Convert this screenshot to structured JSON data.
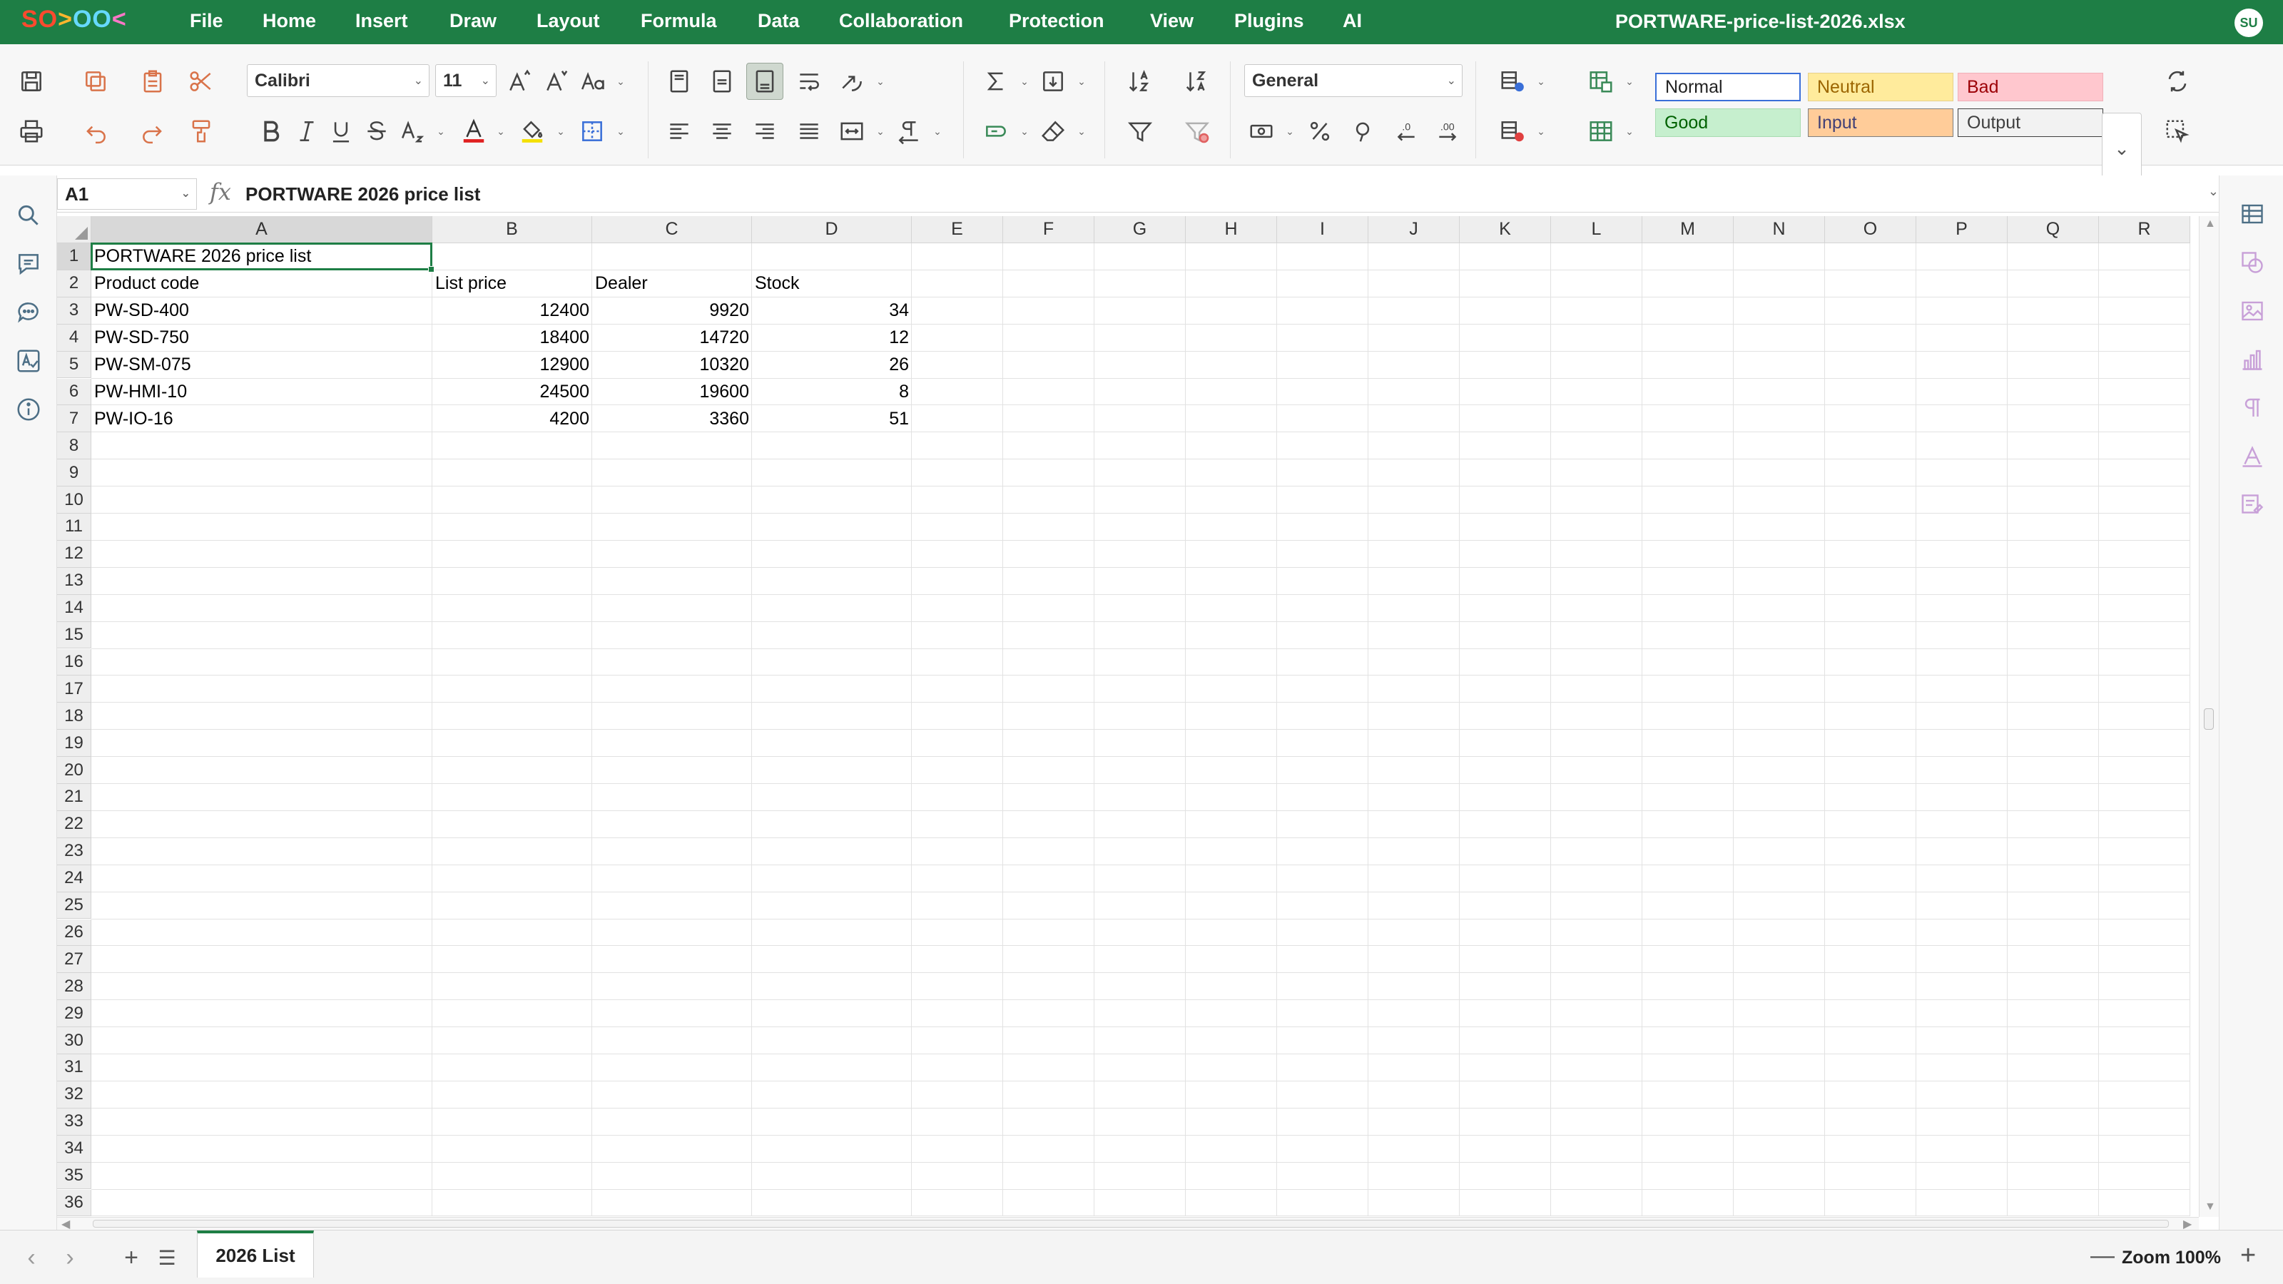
{
  "app": {
    "logo": [
      "SO",
      ">",
      "OO",
      "<"
    ],
    "document_title": "PORTWARE-price-list-2026.xlsx",
    "user_initials": "SU"
  },
  "menu": [
    "File",
    "Home",
    "Insert",
    "Draw",
    "Layout",
    "Formula",
    "Data",
    "Collaboration",
    "Protection",
    "View",
    "Plugins",
    "AI"
  ],
  "toolbar": {
    "font_name": "Calibri",
    "font_size": "11",
    "number_format": "General"
  },
  "cell_styles": [
    {
      "label": "Normal",
      "bg": "#ffffff",
      "fg": "#222222",
      "border": "#3a6fd8"
    },
    {
      "label": "Neutral",
      "bg": "#ffeb9c",
      "fg": "#9c6500",
      "border": "#e6d08a"
    },
    {
      "label": "Bad",
      "bg": "#ffc7ce",
      "fg": "#9c0006",
      "border": "#f0b0b8"
    },
    {
      "label": "Good",
      "bg": "#c6efce",
      "fg": "#006100",
      "border": "#a9dcb2"
    },
    {
      "label": "Input",
      "bg": "#ffcc99",
      "fg": "#3f3f76",
      "border": "#7f7f7f"
    },
    {
      "label": "Output",
      "bg": "#f2f2f2",
      "fg": "#3f3f3f",
      "border": "#3f3f3f"
    }
  ],
  "formula_bar": {
    "name_box": "A1",
    "fx": "fx",
    "value": "PORTWARE 2026 price list"
  },
  "sheet": {
    "columns": [
      "A",
      "B",
      "C",
      "D",
      "E",
      "F",
      "G",
      "H",
      "I",
      "J",
      "K",
      "L",
      "M",
      "N",
      "O",
      "P",
      "Q",
      "R"
    ],
    "row_count": 36,
    "active_cell": "A1",
    "cells": [
      {
        "ref": "A1",
        "value": "PORTWARE 2026 price list",
        "align": "left"
      },
      {
        "ref": "A2",
        "value": "Product code",
        "align": "left"
      },
      {
        "ref": "B2",
        "value": "List price",
        "align": "left"
      },
      {
        "ref": "C2",
        "value": "Dealer",
        "align": "left"
      },
      {
        "ref": "D2",
        "value": "Stock",
        "align": "left"
      },
      {
        "ref": "A3",
        "value": "PW-SD-400",
        "align": "left"
      },
      {
        "ref": "B3",
        "value": "12400",
        "align": "right"
      },
      {
        "ref": "C3",
        "value": "9920",
        "align": "right"
      },
      {
        "ref": "D3",
        "value": "34",
        "align": "right"
      },
      {
        "ref": "A4",
        "value": "PW-SD-750",
        "align": "left"
      },
      {
        "ref": "B4",
        "value": "18400",
        "align": "right"
      },
      {
        "ref": "C4",
        "value": "14720",
        "align": "right"
      },
      {
        "ref": "D4",
        "value": "12",
        "align": "right"
      },
      {
        "ref": "A5",
        "value": "PW-SM-075",
        "align": "left"
      },
      {
        "ref": "B5",
        "value": "12900",
        "align": "right"
      },
      {
        "ref": "C5",
        "value": "10320",
        "align": "right"
      },
      {
        "ref": "D5",
        "value": "26",
        "align": "right"
      },
      {
        "ref": "A6",
        "value": "PW-HMI-10",
        "align": "left"
      },
      {
        "ref": "B6",
        "value": "24500",
        "align": "right"
      },
      {
        "ref": "C6",
        "value": "19600",
        "align": "right"
      },
      {
        "ref": "D6",
        "value": "8",
        "align": "right"
      },
      {
        "ref": "A7",
        "value": "PW-IO-16",
        "align": "left"
      },
      {
        "ref": "B7",
        "value": "4200",
        "align": "right"
      },
      {
        "ref": "C7",
        "value": "3360",
        "align": "right"
      },
      {
        "ref": "D7",
        "value": "51",
        "align": "right"
      }
    ]
  },
  "status": {
    "sheet_tab": "2026 List",
    "zoom_label": "Zoom 100%"
  }
}
